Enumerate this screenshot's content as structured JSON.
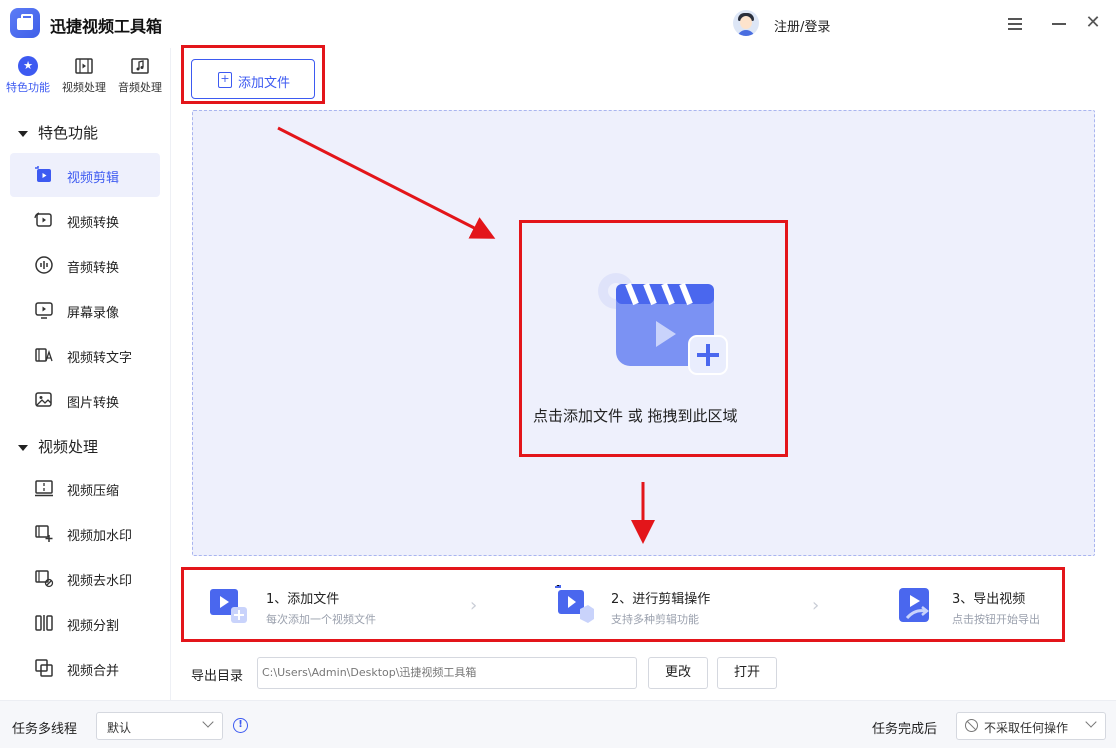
{
  "titlebar": {
    "app_title": "迅捷视频工具箱",
    "login_label": "注册/登录"
  },
  "sidebar": {
    "category_tabs": [
      {
        "label": "特色功能",
        "icon": "star-icon",
        "active": true
      },
      {
        "label": "视频处理",
        "icon": "film-icon",
        "active": false
      },
      {
        "label": "音频处理",
        "icon": "music-icon",
        "active": false
      }
    ],
    "sections": [
      {
        "title": "特色功能",
        "items": [
          {
            "label": "视频剪辑",
            "icon": "video-edit-icon",
            "active": true
          },
          {
            "label": "视频转换",
            "icon": "video-convert-icon",
            "active": false
          },
          {
            "label": "音频转换",
            "icon": "audio-convert-icon",
            "active": false
          },
          {
            "label": "屏幕录像",
            "icon": "screen-record-icon",
            "active": false
          },
          {
            "label": "视频转文字",
            "icon": "video-to-text-icon",
            "active": false
          },
          {
            "label": "图片转换",
            "icon": "image-convert-icon",
            "active": false
          }
        ]
      },
      {
        "title": "视频处理",
        "items": [
          {
            "label": "视频压缩",
            "icon": "video-compress-icon",
            "active": false
          },
          {
            "label": "视频加水印",
            "icon": "add-watermark-icon",
            "active": false
          },
          {
            "label": "视频去水印",
            "icon": "remove-watermark-icon",
            "active": false
          },
          {
            "label": "视频分割",
            "icon": "video-split-icon",
            "active": false
          },
          {
            "label": "视频合并",
            "icon": "video-merge-icon",
            "active": false
          }
        ]
      }
    ]
  },
  "main": {
    "add_file_label": "添加文件",
    "dropzone_text": "点击添加文件 或 拖拽到此区域",
    "steps": [
      {
        "title": "1、添加文件",
        "desc": "每次添加一个视频文件"
      },
      {
        "title": "2、进行剪辑操作",
        "desc": "支持多种剪辑功能"
      },
      {
        "title": "3、导出视频",
        "desc": "点击按钮开始导出"
      }
    ],
    "output": {
      "label": "导出目录",
      "path": "C:\\Users\\Admin\\Desktop\\迅捷视频工具箱",
      "change_label": "更改",
      "open_label": "打开"
    }
  },
  "bottombar": {
    "multithread_label": "任务多线程",
    "multithread_value": "默认",
    "after_done_label": "任务完成后",
    "after_done_value": "不采取任何操作"
  },
  "colors": {
    "accent": "#3d5af1",
    "dropzone_bg": "#eef0fc",
    "annotation_red": "#e3151a"
  }
}
